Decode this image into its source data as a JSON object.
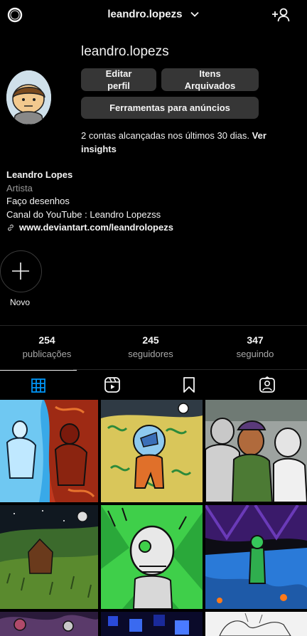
{
  "topbar": {
    "username": "leandro.lopezs",
    "settings_icon": "settings-ring-icon",
    "add_user_icon": "add-user-icon"
  },
  "profile": {
    "name": "leandro.lopezs",
    "buttons": {
      "edit": "Editar perfil",
      "archived": "Itens Arquivados",
      "ads": "Ferramentas para anúncios"
    },
    "reach_text": "2 contas alcançadas nos últimos 30 dias.",
    "reach_link": "Ver insights"
  },
  "bio": {
    "full_name": "Leandro Lopes",
    "category": "Artista",
    "line1": "Faço desenhos",
    "line2": "Canal do YouTube : Leandro Lopezss",
    "website": "www.deviantart.com/leandrolopezs"
  },
  "highlights": {
    "new_label": "Novo"
  },
  "stats": [
    {
      "value": "254",
      "label": "publicações"
    },
    {
      "value": "245",
      "label": "seguidores"
    },
    {
      "value": "347",
      "label": "seguindo"
    }
  ],
  "tabs": [
    {
      "icon": "grid-icon",
      "active": true
    },
    {
      "icon": "reels-icon",
      "active": false
    },
    {
      "icon": "bookmark-icon",
      "active": false
    },
    {
      "icon": "tagged-icon",
      "active": false
    }
  ],
  "colors": {
    "background": "#000000",
    "button_bg": "#363636",
    "secondary_text": "#a8a8a8",
    "active_tab": "#0095f6"
  }
}
